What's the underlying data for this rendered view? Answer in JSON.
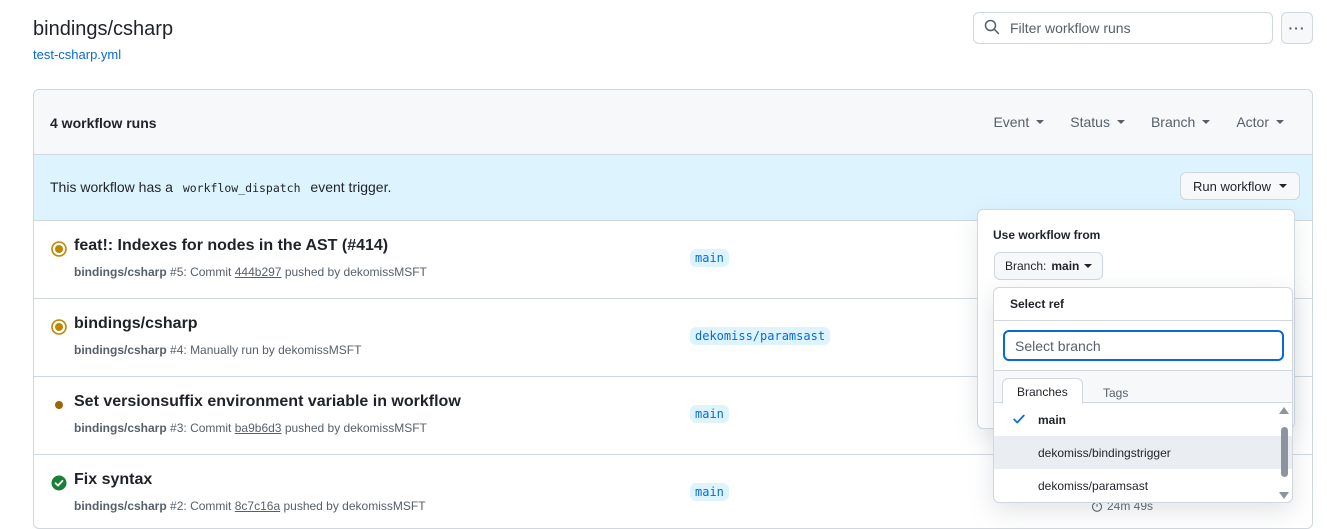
{
  "header": {
    "title": "bindings/csharp",
    "workflow_file": "test-csharp.yml",
    "filter_placeholder": "Filter workflow runs",
    "more_icon": "kebab-horizontal-icon"
  },
  "box": {
    "runs_count": "4 workflow runs",
    "filters": [
      "Event",
      "Status",
      "Branch",
      "Actor"
    ],
    "dispatch": {
      "prefix": "This workflow has a",
      "code": "workflow_dispatch",
      "suffix": "event trigger.",
      "button": "Run workflow"
    }
  },
  "runs": [
    {
      "title": "feat!: Indexes for nodes in the AST (#414)",
      "status": "in-progress",
      "workflow": "bindings/csharp",
      "number": "#5:",
      "meta_prefix": "Commit",
      "sha": "444b297",
      "meta_suffix": "pushed by dekomissMSFT",
      "branch": "main"
    },
    {
      "title": "bindings/csharp",
      "status": "in-progress",
      "workflow": "bindings/csharp",
      "number": "#4:",
      "meta_prefix": "Manually run by dekomissMSFT",
      "sha": "",
      "meta_suffix": "",
      "branch": "dekomiss/paramsast"
    },
    {
      "title": "Set versionsuffix environment variable in workflow",
      "status": "queued",
      "workflow": "bindings/csharp",
      "number": "#3:",
      "meta_prefix": "Commit",
      "sha": "ba9b6d3",
      "meta_suffix": "pushed by dekomissMSFT",
      "branch": "main"
    },
    {
      "title": "Fix syntax",
      "status": "success",
      "workflow": "bindings/csharp",
      "number": "#2:",
      "meta_prefix": "Commit",
      "sha": "8c7c16a",
      "meta_suffix": "pushed by dekomissMSFT",
      "branch": "main",
      "duration": "24m 49s"
    }
  ],
  "popover": {
    "label": "Use workflow from",
    "branch_prefix": "Branch:",
    "branch_value": "main"
  },
  "select_ref": {
    "title": "Select ref",
    "placeholder": "Select branch",
    "tabs": [
      "Branches",
      "Tags"
    ],
    "items": [
      {
        "label": "main",
        "selected": true
      },
      {
        "label": "dekomiss/bindingstrigger",
        "selected": false
      },
      {
        "label": "dekomiss/paramsast",
        "selected": false
      }
    ]
  },
  "colors": {
    "accent": "#0969da",
    "in_progress": "#bf8700",
    "queued": "#9a6700",
    "success": "#1a7f37",
    "info_bg": "#ddf4ff"
  }
}
